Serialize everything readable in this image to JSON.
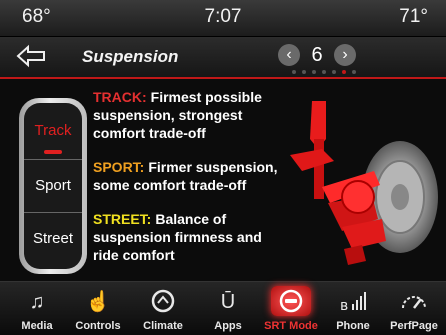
{
  "status": {
    "temp_left": "68°",
    "time": "7:07",
    "temp_right": "71°"
  },
  "header": {
    "title": "Suspension",
    "page_number": "6",
    "page_count": 7,
    "page_current_index": 5
  },
  "selector": {
    "options": [
      "Track",
      "Sport",
      "Street"
    ],
    "selected": "Track"
  },
  "modes": [
    {
      "name": "TRACK:",
      "text": "Firmest possible suspension, strongest comfort trade-off",
      "color": "#e53030"
    },
    {
      "name": "SPORT:",
      "text": "Firmer suspension, some comfort trade-off",
      "color": "#f0a020"
    },
    {
      "name": "STREET:",
      "text": "Balance of suspension firmness and ride comfort",
      "color": "#f0e020"
    }
  ],
  "nav": {
    "items": [
      {
        "label": "Media",
        "icon": "music-note-icon"
      },
      {
        "label": "Controls",
        "icon": "hand-controls-icon"
      },
      {
        "label": "Climate",
        "icon": "climate-icon"
      },
      {
        "label": "Apps",
        "icon": "apps-icon"
      },
      {
        "label": "SRT Mode",
        "icon": "srt-steering-wheel-icon"
      },
      {
        "label": "Phone",
        "icon": "phone-bluetooth-icon"
      },
      {
        "label": "PerfPage",
        "icon": "perf-gauge-icon"
      }
    ],
    "active": "SRT Mode"
  },
  "colors": {
    "accent": "#c01818",
    "track": "#e53030",
    "sport": "#f0a020",
    "street": "#f0e020"
  }
}
